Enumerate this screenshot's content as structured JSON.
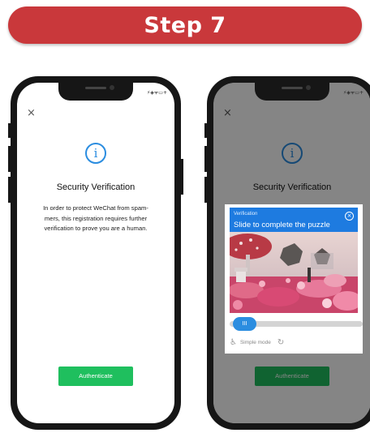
{
  "banner": {
    "title": "Step 7"
  },
  "phone1": {
    "status": "⚡◈ᯤ▭+",
    "close": "×",
    "info_icon": "i",
    "title": "Security Verification",
    "description": "In order to protect WeChat from spam-mers, this registration requires further verification to prove you are a human.",
    "button": "Authenticate"
  },
  "phone2": {
    "status": "⚡◈ᯤ▭+",
    "close": "×",
    "info_icon": "i",
    "title": "Security Verification",
    "button": "Authenticate",
    "puzzle": {
      "header_small": "Verification",
      "header_title": "Slide to complete the puzzle",
      "close": "×",
      "slider_grip": "III",
      "slider_progress": 0.0,
      "simple_mode": "Simple mode",
      "accessibility_icon": "accessibility-icon",
      "refresh_icon": "refresh-icon"
    }
  },
  "colors": {
    "banner": "#c9383b",
    "accent_green": "#1fbf5e",
    "accent_blue": "#1e7be0"
  }
}
